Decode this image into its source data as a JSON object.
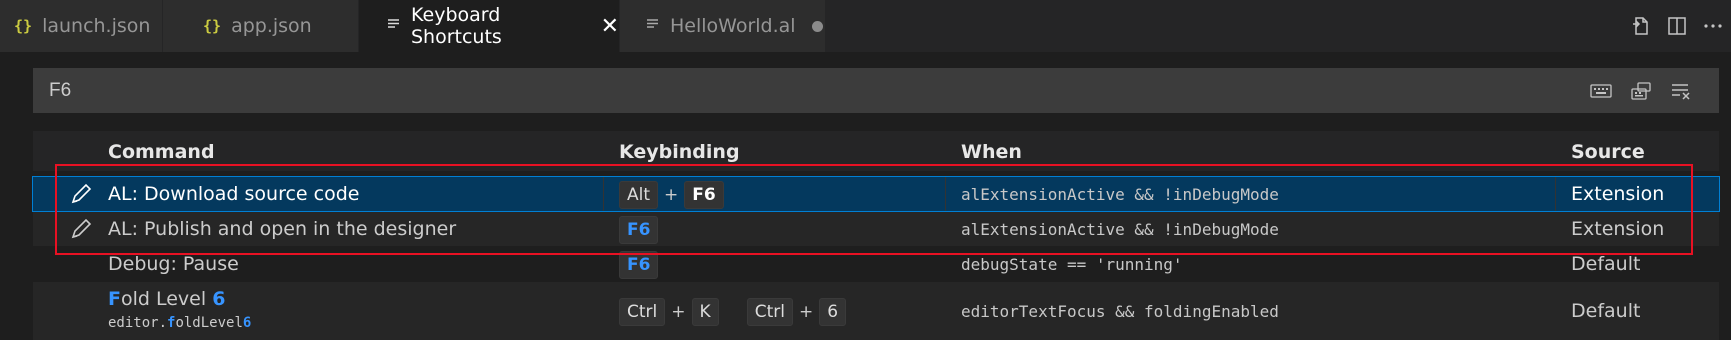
{
  "tabs": [
    {
      "label": "launch.json",
      "icon": "json-braces-icon"
    },
    {
      "label": "app.json",
      "icon": "json-braces-icon"
    },
    {
      "label": "Keyboard Shortcuts",
      "icon": "lines-icon",
      "active": true
    },
    {
      "label": "HelloWorld.al",
      "icon": "lines-icon",
      "dirty": true
    }
  ],
  "search": {
    "value": "F6"
  },
  "table": {
    "headers": {
      "command": "Command",
      "keybinding": "Keybinding",
      "when": "When",
      "source": "Source"
    },
    "rows": [
      {
        "command": "AL: Download source code",
        "keys": [
          "Alt",
          "F6"
        ],
        "when": "alExtensionActive && !inDebugMode",
        "source": "Extension"
      },
      {
        "command": "AL: Publish and open in the designer",
        "keys": [
          "F6"
        ],
        "when": "alExtensionActive && !inDebugMode",
        "source": "Extension"
      },
      {
        "command": "Debug: Pause",
        "keys": [
          "F6"
        ],
        "when": "debugState == 'running'",
        "source": "Default"
      },
      {
        "command_pre": "F",
        "command_mid": "old Level ",
        "command_post": "6",
        "command_id_a": "editor.",
        "command_id_b": "f",
        "command_id_c": "oldLevel",
        "command_id_d": "6",
        "keys1": [
          "Ctrl",
          "K"
        ],
        "keys2": [
          "Ctrl",
          "6"
        ],
        "when": "editorTextFocus && foldingEnabled",
        "source": "Default"
      }
    ]
  },
  "plus": "+",
  "close_glyph": "✕",
  "json_glyph": "{}",
  "colors": {
    "accent": "#3794ff",
    "selection": "#04395e",
    "highlight_box": "#e81123"
  }
}
